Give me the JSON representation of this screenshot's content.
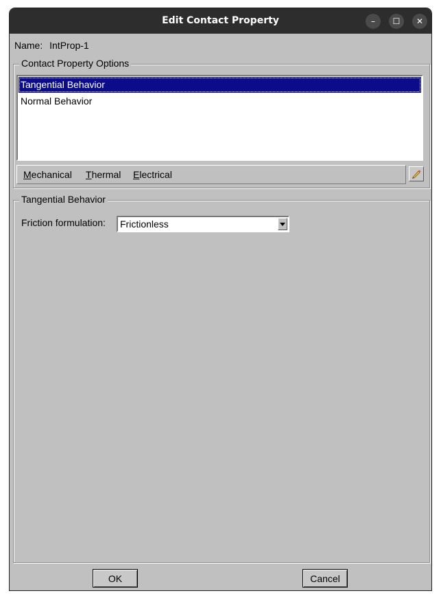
{
  "window": {
    "title": "Edit Contact Property",
    "controls": {
      "minimize": "–",
      "maximize": "☐",
      "close": "✕"
    }
  },
  "name": {
    "label": "Name:",
    "value": "IntProp-1"
  },
  "options_group": {
    "legend": "Contact Property Options",
    "items": [
      "Tangential Behavior",
      "Normal Behavior"
    ],
    "selected_index": 0
  },
  "menus": [
    {
      "underlined": "M",
      "rest": "echanical"
    },
    {
      "underlined": "T",
      "rest": "hermal"
    },
    {
      "underlined": "E",
      "rest": "lectrical"
    }
  ],
  "behavior_group": {
    "legend": "Tangential Behavior",
    "friction_label": "Friction formulation:",
    "friction_value": "Frictionless"
  },
  "buttons": {
    "ok": "OK",
    "cancel": "Cancel"
  },
  "colors": {
    "selection": "#0c0c8a",
    "titlebar": "#2d2d2d",
    "panel": "#c0c0c0"
  },
  "icons": {
    "pick": "pencil-icon"
  }
}
